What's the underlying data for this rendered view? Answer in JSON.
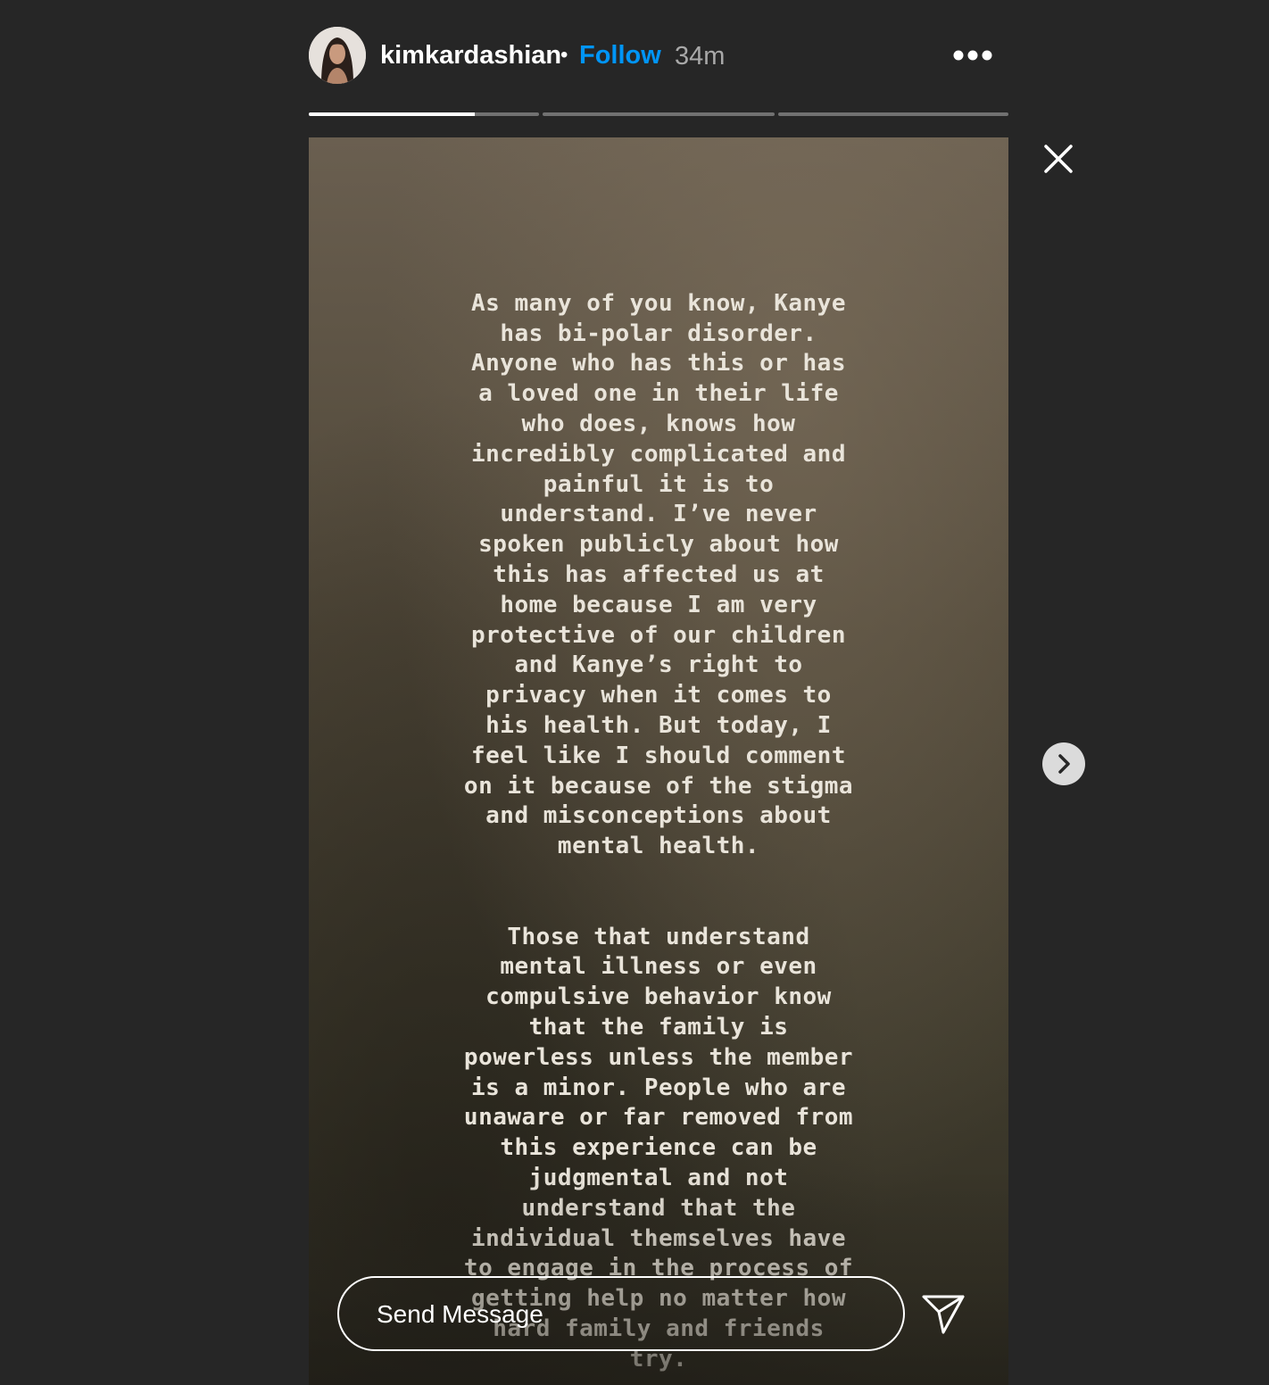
{
  "header": {
    "username": "kimkardashian",
    "separator": "•",
    "follow_label": "Follow",
    "time": "34m",
    "more_icon": "more-horizontal-icon"
  },
  "progress": [
    {
      "fill": 0.72
    },
    {
      "fill": 0
    },
    {
      "fill": 0
    }
  ],
  "story": {
    "paragraph1": "As many of you know, Kanye\nhas bi-polar disorder.\nAnyone who has this or has\na loved one in their life\nwho does, knows how\nincredibly complicated and\npainful it is to\nunderstand. I’ve never\nspoken publicly about how\nthis has affected us at\nhome because I am very\nprotective of our children\nand Kanye’s right to\nprivacy when it comes to\nhis health. But today, I\nfeel like I should comment\non it because of the stigma\nand misconceptions about\nmental health.",
    "paragraph2": "Those that understand\nmental illness or even\ncompulsive behavior know\nthat the family is\npowerless unless the member\nis a minor. People who are\nunaware or far removed from\nthis experience can be\njudgmental and not\nunderstand that the\nindividual themselves have\nto engage in the process of\ngetting help no matter how\nhard family and friends\ntry."
  },
  "reply": {
    "placeholder": "Send Message"
  },
  "icons": {
    "close": "close-icon",
    "next": "chevron-right-icon",
    "send": "send-icon"
  },
  "colors": {
    "background": "#262626",
    "follow": "#0095f6",
    "time": "#a8a8a8"
  }
}
